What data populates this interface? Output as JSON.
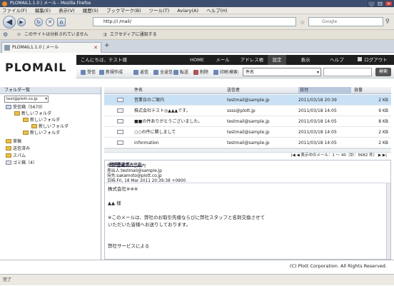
{
  "browser": {
    "window_title": "PLOMAIL1.1.0 | メール - Mozilla Firefox",
    "menu": [
      "ファイル(F)",
      "編集(E)",
      "表示(V)",
      "履歴(S)",
      "ブックマーク(B)",
      "ツール(T)",
      "Aviary(A)",
      "ヘルプ(H)"
    ],
    "url": "http://i          /mail/",
    "search_placeholder": "Google",
    "notification": "このサイトは分析されていません",
    "ext_label": "エクセディアに通知する",
    "tab_title": "PLOMAIL1.1.0 | メール"
  },
  "app": {
    "logo": "PLOMAIL",
    "greeting": "こんにちは、テスト様",
    "nav": [
      "HOME",
      "メール",
      "アドレス帳",
      "設定",
      "表示",
      "ヘルプ",
      "ログアウト"
    ],
    "tools": [
      "受信",
      "新規作成",
      "返信",
      "全返信",
      "転送",
      "削除",
      "印刷",
      "検索:"
    ],
    "search_value": "件名",
    "search_button": "検索"
  },
  "folders": {
    "header": "フォルダ一覧",
    "account": "test@plott.co.jp",
    "items": [
      {
        "label": "受信箱（5670）",
        "icon": "mail"
      },
      {
        "label": "新しいフォルダ",
        "icon": "folder"
      },
      {
        "label": "新しいフォルダ",
        "icon": "folder"
      },
      {
        "label": "新しいフォルダ",
        "icon": "folder"
      },
      {
        "label": "新しいフォルダ",
        "icon": "folder"
      },
      {
        "label": "草稿",
        "icon": "folder"
      },
      {
        "label": "送信済み",
        "icon": "folder"
      },
      {
        "label": "スパム",
        "icon": "folder"
      },
      {
        "label": "ゴミ箱（4）",
        "icon": "trash"
      }
    ]
  },
  "list": {
    "columns": [
      "件名",
      "送信者",
      "日付",
      "容量"
    ],
    "rows": [
      {
        "subject": "営業日のご案内",
        "from": "testmail@sample.jp",
        "date": "2011/03/18 20:39",
        "size": "2 KB"
      },
      {
        "subject": "株式会社テスト◎▲▲▲です。",
        "from": "ssss@plott.jp",
        "date": "2011/03/18 14:05",
        "size": "9 KB"
      },
      {
        "subject": "■■の件ありがとうございました。",
        "from": "testmail@sample.jp",
        "date": "2011/03/18 14:05",
        "size": "8 KB"
      },
      {
        "subject": "○○の件に関しまして",
        "from": "testmail@sample.jp",
        "date": "2011/03/18 14:05",
        "size": "2 KB"
      },
      {
        "subject": "information",
        "from": "testmail@sample.jp",
        "date": "2011/03/18 14:05",
        "size": "2 KB"
      }
    ],
    "pager": "表示中のメール：1 〜 40（計：5682 件）"
  },
  "preview": {
    "subject": "件名 営業日のご案内",
    "from": "差出人:testmail@sample.jp",
    "to": "宛先:sakamoto@plott.co.jp",
    "date": "日時:Fri, 18 Mar 2011 20:39:38 +0900",
    "attach": [
      "詳細ヘッダー",
      "emlファイル出力",
      "eml再送信"
    ],
    "body": [
      "株式会社※※※",
      "",
      "▲▲ 様",
      "",
      "※このメールは、弊社のお取引先様ならびに弊社スタッフと名刺交換させて",
      "いただいた皆様へお送りしております。",
      "",
      "",
      "弊社サービスによる"
    ]
  },
  "footer": "(C) Plott Corporation. All Rights Reserved.",
  "statusbar": "完了"
}
